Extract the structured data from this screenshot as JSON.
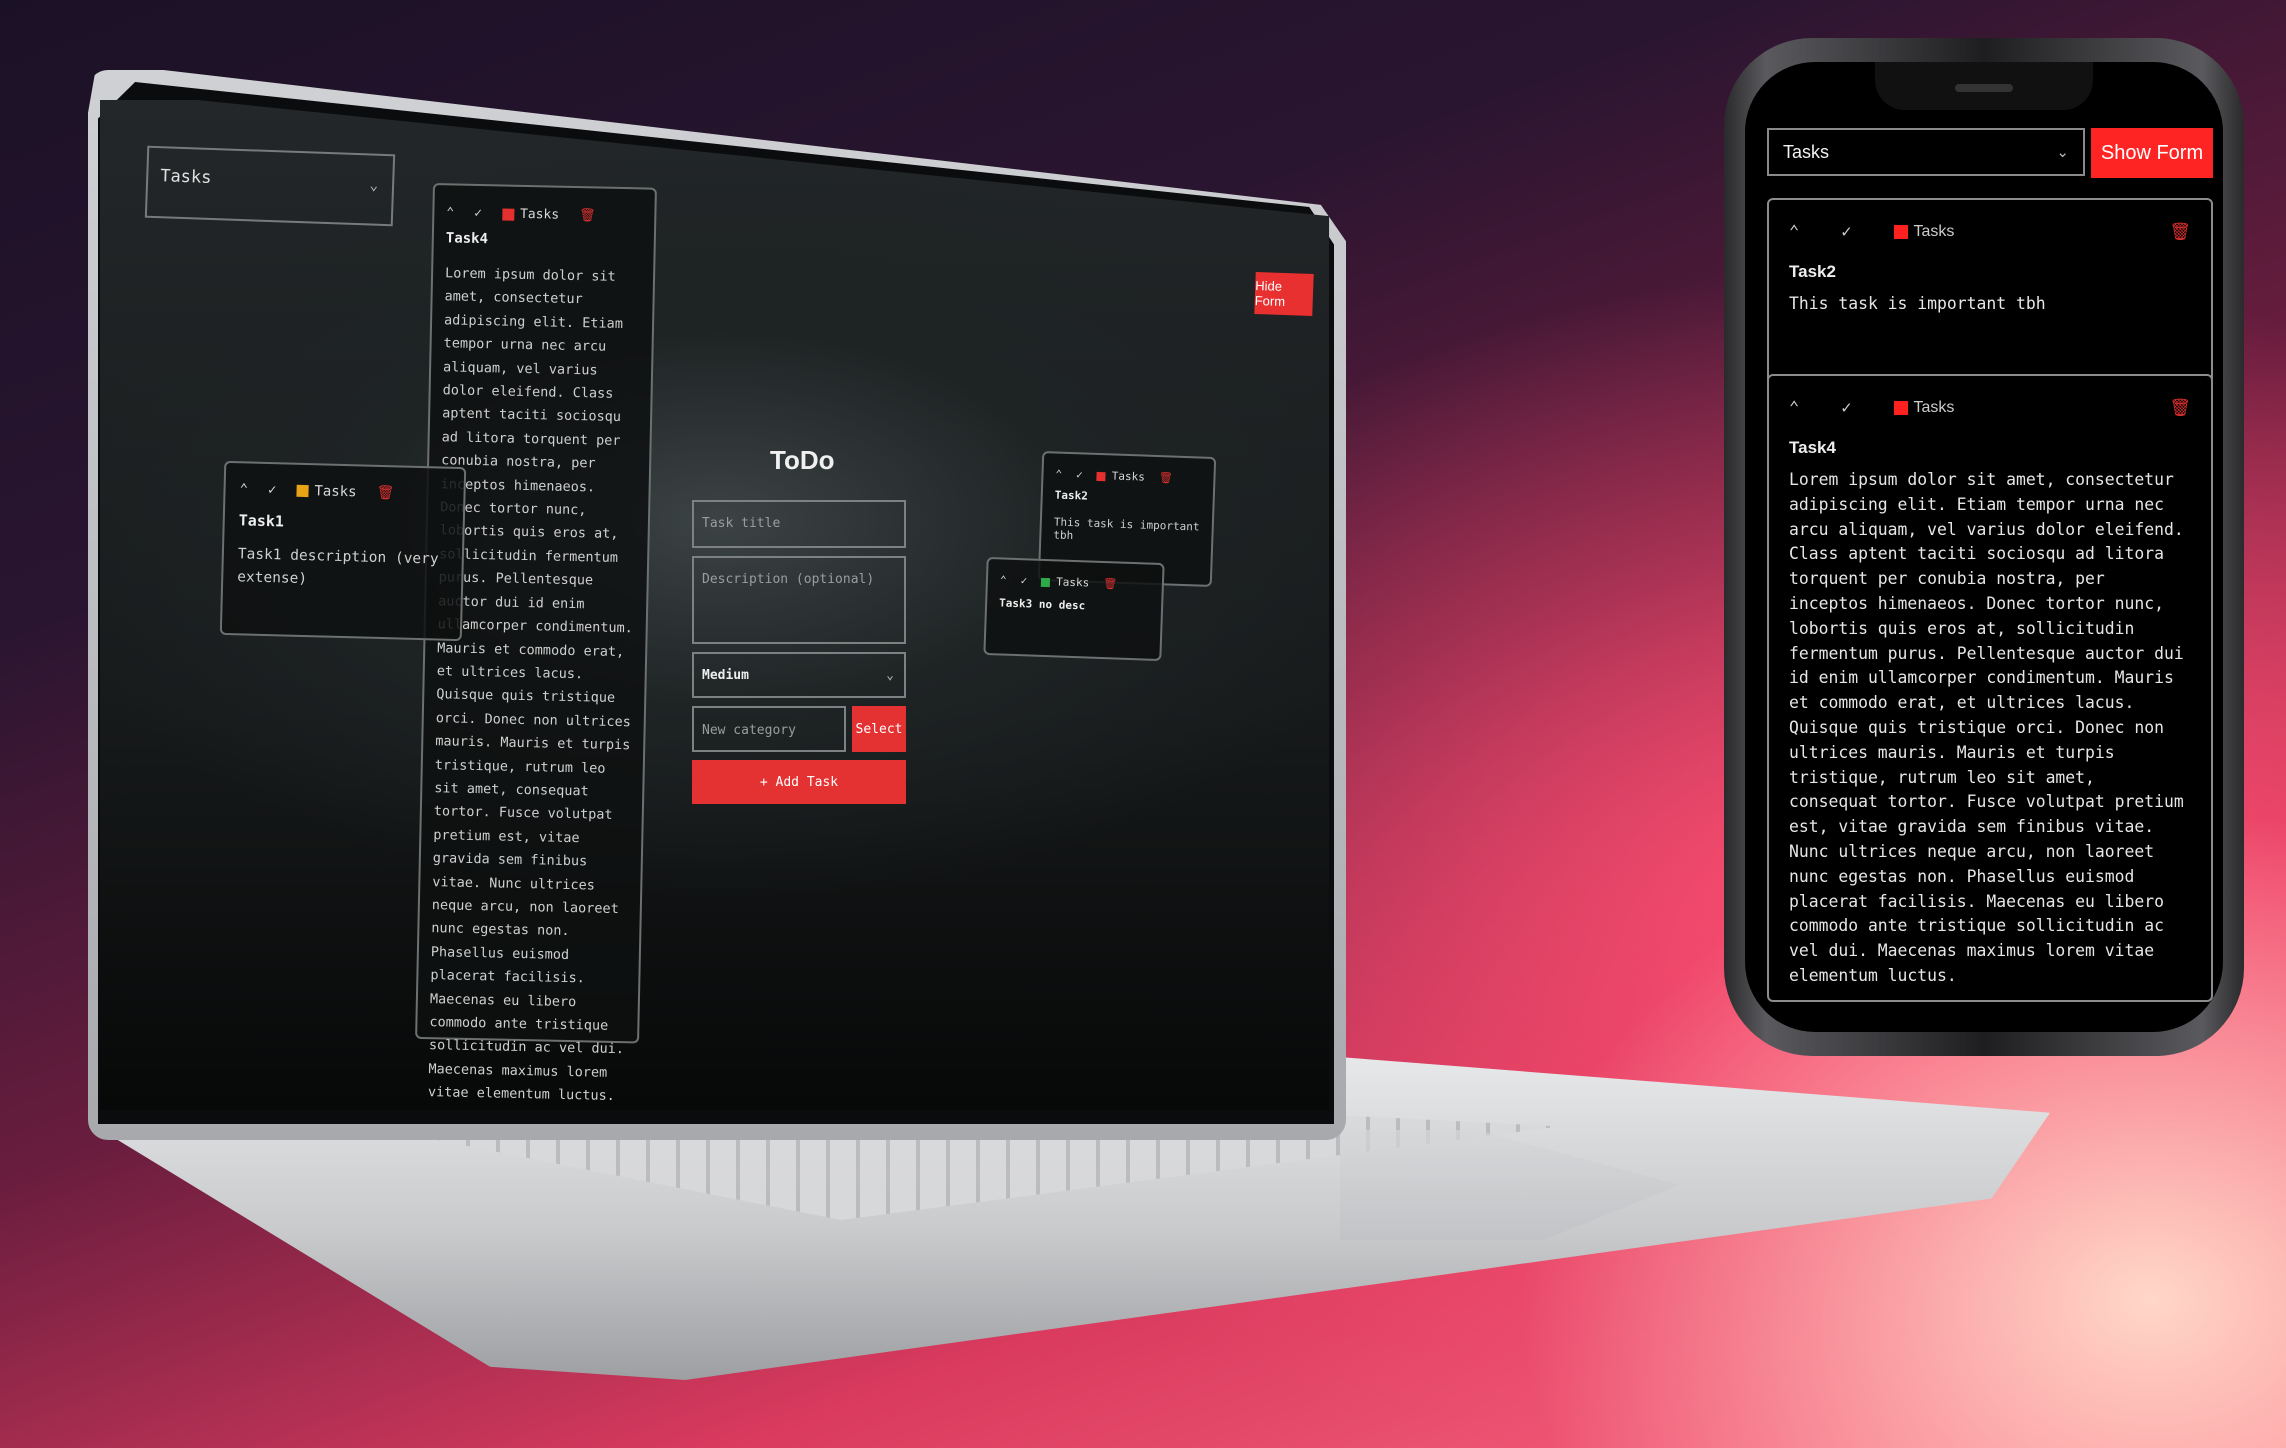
{
  "laptop": {
    "category_select": "Tasks",
    "hide_form_label": "Hide Form",
    "form": {
      "title": "ToDo",
      "task_title_placeholder": "Task title",
      "description_placeholder": "Description (optional)",
      "priority": "Medium",
      "category_placeholder": "New category",
      "select_label": "Select",
      "add_task_label": "+ Add Task"
    },
    "cards": {
      "task4": {
        "category": "Tasks",
        "title": "Task4",
        "description": "Lorem ipsum dolor sit amet, consectetur adipiscing elit. Etiam tempor urna nec arcu aliquam, vel varius dolor eleifend. Class aptent taciti sociosqu ad litora torquent per conubia nostra, per inceptos himenaeos. Donec tortor nunc, lobortis quis eros at, sollicitudin fermentum purus. Pellentesque auctor dui id enim ullamcorper condimentum. Mauris et commodo erat, et ultrices lacus. Quisque quis tristique orci. Donec non ultrices mauris. Mauris et turpis tristique, rutrum leo sit amet, consequat tortor. Fusce volutpat pretium est, vitae gravida sem finibus vitae. Nunc ultrices neque arcu, non laoreet nunc egestas non. Phasellus euismod placerat facilisis. Maecenas eu libero commodo ante tristique sollicitudin ac vel dui. Maecenas maximus lorem vitae elementum luctus.",
        "color": "#e53030"
      },
      "task1": {
        "category": "Tasks",
        "title": "Task1",
        "description": "Task1 description (very extense)",
        "color": "#e8a317"
      },
      "task2": {
        "category": "Tasks",
        "title": "Task2",
        "description": "This task is important tbh",
        "color": "#e53030"
      },
      "task3": {
        "category": "Tasks",
        "title": "Task3 no desc",
        "color": "#2faa4a"
      }
    }
  },
  "phone": {
    "category_select": "Tasks",
    "show_form_label": "Show Form",
    "cards": [
      {
        "category": "Tasks",
        "title": "Task2",
        "description": "This task is important tbh",
        "color": "#ff2020"
      },
      {
        "category": "Tasks",
        "title": "Task4",
        "description": "Lorem ipsum dolor sit amet, consectetur adipiscing elit. Etiam tempor urna nec arcu aliquam, vel varius dolor eleifend. Class aptent taciti sociosqu ad litora torquent per conubia nostra, per inceptos himenaeos. Donec tortor nunc, lobortis quis eros at, sollicitudin fermentum purus. Pellentesque auctor dui id enim ullamcorper condimentum. Mauris et commodo erat, et ultrices lacus. Quisque quis tristique orci. Donec non ultrices mauris. Mauris et turpis tristique, rutrum leo sit amet, consequat tortor. Fusce volutpat pretium est, vitae gravida sem finibus vitae. Nunc ultrices neque arcu, non laoreet nunc egestas non. Phasellus euismod placerat facilisis. Maecenas eu libero commodo ante tristique sollicitudin ac vel dui. Maecenas maximus lorem vitae elementum luctus.",
        "color": "#ff2020"
      }
    ]
  },
  "icons": {
    "collapse": "chevron-up-icon",
    "complete": "check-icon",
    "delete": "trash-icon",
    "dropdown": "chevron-down-icon"
  }
}
